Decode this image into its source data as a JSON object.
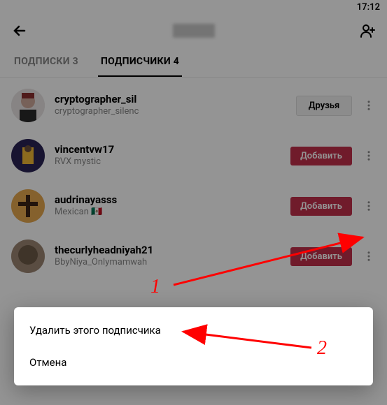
{
  "status": {
    "time": "17:12"
  },
  "header": {
    "title": ""
  },
  "tabs": [
    {
      "label": "ПОДПИСКИ 3",
      "active": false
    },
    {
      "label": "ПОДПИСЧИКИ 4",
      "active": true
    }
  ],
  "followers": [
    {
      "name": "cryptographer_sil",
      "bio": "cryptographer_silenc",
      "action": "Друзья",
      "action_type": "friends"
    },
    {
      "name": "vincentvw17",
      "bio": "RVX mystic",
      "action": "Добавить",
      "action_type": "add"
    },
    {
      "name": "audrinayasss",
      "bio": "Mexican 🇲🇽",
      "action": "Добавить",
      "action_type": "add"
    },
    {
      "name": "thecurlyheadniyah21",
      "bio": "BbyNiya_Onlymamwah",
      "action": "Добавить",
      "action_type": "add"
    }
  ],
  "sheet": {
    "delete": "Удалить этого подписчика",
    "cancel": "Отмена"
  },
  "annotations": {
    "num1": "1",
    "num2": "2"
  },
  "colors": {
    "accent": "#c1304b",
    "anno": "#ff0000"
  },
  "avatars": [
    {
      "bg": "#dcdcdc",
      "shape": "person-red"
    },
    {
      "bg": "#2a2355",
      "shape": "lakers"
    },
    {
      "bg": "#e6a84f",
      "shape": "cross"
    },
    {
      "bg": "#8a7560",
      "shape": "blur"
    }
  ]
}
